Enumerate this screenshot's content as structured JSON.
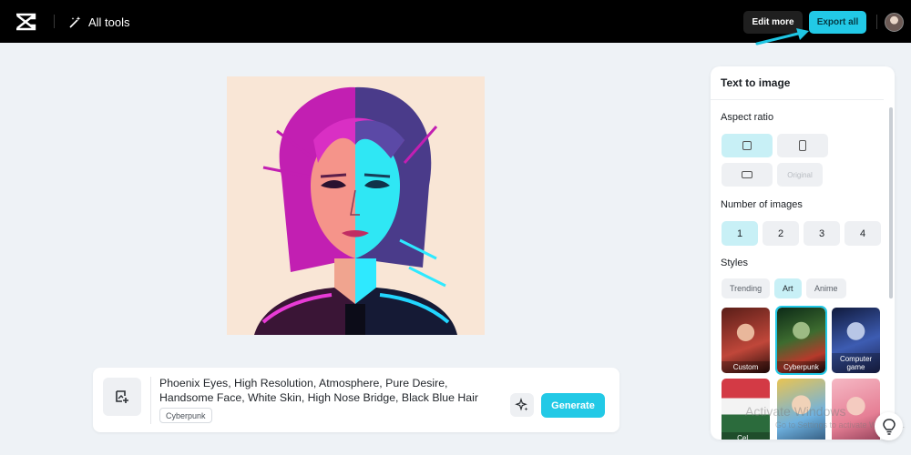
{
  "header": {
    "logo_icon": "capcut-logo-icon",
    "all_tools_label": "All tools",
    "all_tools_icon": "magic-wand-icon",
    "edit_more_label": "Edit more",
    "export_all_label": "Export all",
    "accent": "#22c9e6"
  },
  "canvas": {
    "image_subject": "cyberpunk woman portrait, split pink and cyan"
  },
  "prompt": {
    "text": "Phoenix Eyes, High Resolution, Atmosphere, Pure Desire, Handsome Face, White Skin, High Nose Bridge, Black Blue Hair",
    "style_tag": "Cyberpunk",
    "generate_label": "Generate"
  },
  "panel": {
    "title": "Text to image",
    "aspect_ratio_label": "Aspect ratio",
    "aspect_original_label": "Original",
    "number_of_images_label": "Number of images",
    "numbers": [
      "1",
      "2",
      "3",
      "4"
    ],
    "selected_number": "1",
    "styles_label": "Styles",
    "style_tabs": [
      "Trending",
      "Art",
      "Anime"
    ],
    "selected_style_tab": "Art",
    "style_cards": [
      {
        "label": "Custom"
      },
      {
        "label": "Cyberpunk",
        "selected": true
      },
      {
        "label": "Computer game"
      },
      {
        "label": "Cel..."
      },
      {
        "label": ""
      },
      {
        "label": ""
      }
    ]
  },
  "overlay": {
    "watermark_title": "Activate Windows",
    "watermark_sub": "Go to Settings to activate Windows."
  }
}
